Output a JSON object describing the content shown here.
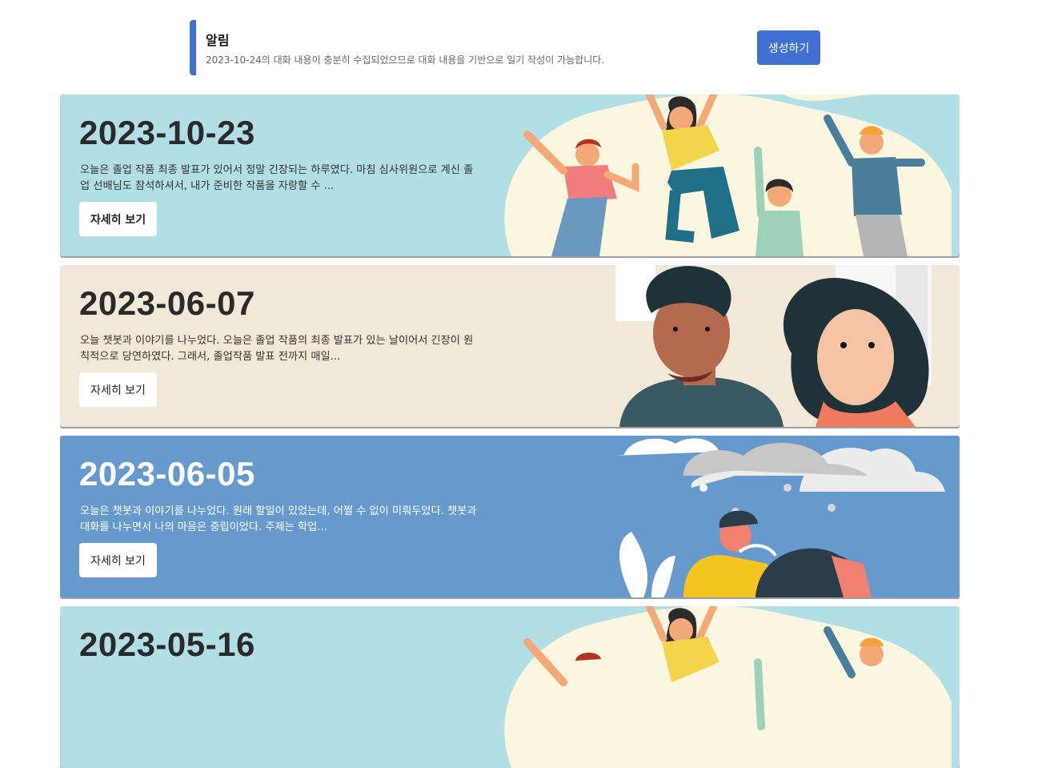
{
  "notice": {
    "title": "알림",
    "message": "2023-10-24의 대화 내용이 충분히 수집되었으므로 대화 내용을 기반으로 일기 작성이 가능합니다.",
    "button_label": "생성하기",
    "accent": "#3f6fd1"
  },
  "entries": [
    {
      "date": "2023-10-23",
      "summary": "오늘은 졸업 작품 최종 발표가 있어서 정말 긴장되는 하루였다. 마침 심사위원으로 계신 졸업 선배님도 참석하셔서, 내가 준비한 작품을 자랑할 수 ...",
      "button_label": "자세히 보기",
      "bg": "#b2dfe5",
      "illustration": "jumping-people"
    },
    {
      "date": "2023-06-07",
      "summary": "오늘 챗봇과 이야기를 나누었다. 오늘은 졸업 작품의 최종 발표가 있는 날이어서 긴장이 원칙적으로 당연하였다. 그래서, 졸업작품 발표 전까지 매일...",
      "button_label": "자세히 보기",
      "bg": "#f2e8d8",
      "illustration": "worried-people"
    },
    {
      "date": "2023-06-05",
      "summary": "오늘은 챗봇과 이야기를 나누었다. 원래 할일이 있었는데, 어쩔 수 없이 미뤄두었다. 챗봇과 대화를 나누면서 나의 마음은 중립이었다. 주제는 학업...",
      "button_label": "자세히 보기",
      "bg": "#6699cc",
      "illustration": "rain-cloud-sad-person"
    },
    {
      "date": "2023-05-16",
      "summary": "",
      "button_label": "",
      "bg": "#b2dfe5",
      "illustration": "jumping-people"
    }
  ]
}
